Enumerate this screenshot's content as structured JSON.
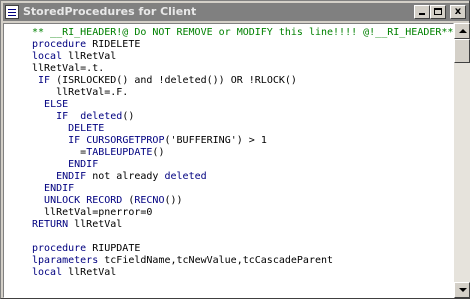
{
  "window": {
    "title": "StoredProcedures for Client",
    "controls": {
      "minimize": "minimize-icon",
      "maximize": "maximize-icon",
      "close_label": "x"
    }
  },
  "colors": {
    "comment": "#008000",
    "keyword": "#000080",
    "text": "#000000",
    "title_bar_inactive": "#808080"
  },
  "scrollbar": {
    "vertical_position": 0.0
  },
  "code_lines": [
    [
      {
        "t": "comment",
        "v": "** __RI_HEADER!@ Do NOT REMOVE or MODIFY this line!!!! @!__RI_HEADER**"
      }
    ],
    [
      {
        "t": "keyword",
        "v": "procedure"
      },
      {
        "t": "text",
        "v": " RIDELETE"
      }
    ],
    [
      {
        "t": "keyword",
        "v": "local"
      },
      {
        "t": "text",
        "v": " llRetVal"
      }
    ],
    [
      {
        "t": "text",
        "v": "llRetVal=.t."
      }
    ],
    [
      {
        "t": "text",
        "v": " "
      },
      {
        "t": "keyword",
        "v": "IF"
      },
      {
        "t": "text",
        "v": " (ISRLOCKED() and !deleted()) OR !RLOCK()"
      }
    ],
    [
      {
        "t": "text",
        "v": "    llRetVal=.F."
      }
    ],
    [
      {
        "t": "text",
        "v": "  "
      },
      {
        "t": "keyword",
        "v": "ELSE"
      }
    ],
    [
      {
        "t": "text",
        "v": "    "
      },
      {
        "t": "keyword",
        "v": "IF"
      },
      {
        "t": "text",
        "v": "  "
      },
      {
        "t": "keyword",
        "v": "deleted"
      },
      {
        "t": "text",
        "v": "()"
      }
    ],
    [
      {
        "t": "text",
        "v": "      "
      },
      {
        "t": "keyword",
        "v": "DELETE"
      }
    ],
    [
      {
        "t": "text",
        "v": "      "
      },
      {
        "t": "keyword",
        "v": "IF"
      },
      {
        "t": "text",
        "v": " "
      },
      {
        "t": "keyword",
        "v": "CURSORGETPROP"
      },
      {
        "t": "text",
        "v": "('BUFFERING') > 1"
      }
    ],
    [
      {
        "t": "text",
        "v": "        ="
      },
      {
        "t": "keyword",
        "v": "TABLEUPDATE"
      },
      {
        "t": "text",
        "v": "()"
      }
    ],
    [
      {
        "t": "text",
        "v": "      "
      },
      {
        "t": "keyword",
        "v": "ENDIF"
      }
    ],
    [
      {
        "t": "text",
        "v": "    "
      },
      {
        "t": "keyword",
        "v": "ENDIF"
      },
      {
        "t": "text",
        "v": " not already "
      },
      {
        "t": "keyword",
        "v": "deleted"
      }
    ],
    [
      {
        "t": "text",
        "v": "  "
      },
      {
        "t": "keyword",
        "v": "ENDIF"
      }
    ],
    [
      {
        "t": "text",
        "v": "  "
      },
      {
        "t": "keyword",
        "v": "UNLOCK RECORD"
      },
      {
        "t": "text",
        "v": " ("
      },
      {
        "t": "keyword",
        "v": "RECNO"
      },
      {
        "t": "text",
        "v": "())"
      }
    ],
    [
      {
        "t": "text",
        "v": "  llRetVal=pnerror=0"
      }
    ],
    [
      {
        "t": "keyword",
        "v": "RETURN"
      },
      {
        "t": "text",
        "v": " llRetVal"
      }
    ],
    [
      {
        "t": "text",
        "v": ""
      }
    ],
    [
      {
        "t": "keyword",
        "v": "procedure"
      },
      {
        "t": "text",
        "v": " RIUPDATE"
      }
    ],
    [
      {
        "t": "keyword",
        "v": "lparameters"
      },
      {
        "t": "text",
        "v": " tcFieldName,tcNewValue,tcCascadeParent"
      }
    ],
    [
      {
        "t": "keyword",
        "v": "local"
      },
      {
        "t": "text",
        "v": " llRetVal"
      }
    ]
  ]
}
